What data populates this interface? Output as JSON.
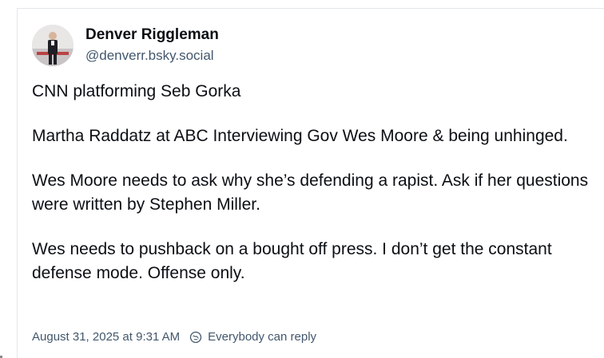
{
  "author": {
    "display_name": "Denver Riggleman",
    "handle": "@denverr.bsky.social",
    "avatar": "profile-photo"
  },
  "post": {
    "paragraphs": [
      "CNN platforming Seb Gorka",
      "Martha Raddatz at ABC Interviewing Gov Wes Moore & being unhinged.",
      "Wes Moore needs to ask why she’s defending a rapist. Ask if her questions were written by Stephen Miller.",
      "Wes needs to pushback on a bought off press. I don’t get the constant defense mode. Offense only."
    ]
  },
  "meta": {
    "timestamp": "August 31, 2025 at 9:31 AM",
    "reply_setting": "Everybody can reply",
    "reply_icon": "globe-reply-icon"
  },
  "colors": {
    "text": "#0b0f14",
    "muted": "#42576c",
    "border": "#e3e6ea"
  }
}
